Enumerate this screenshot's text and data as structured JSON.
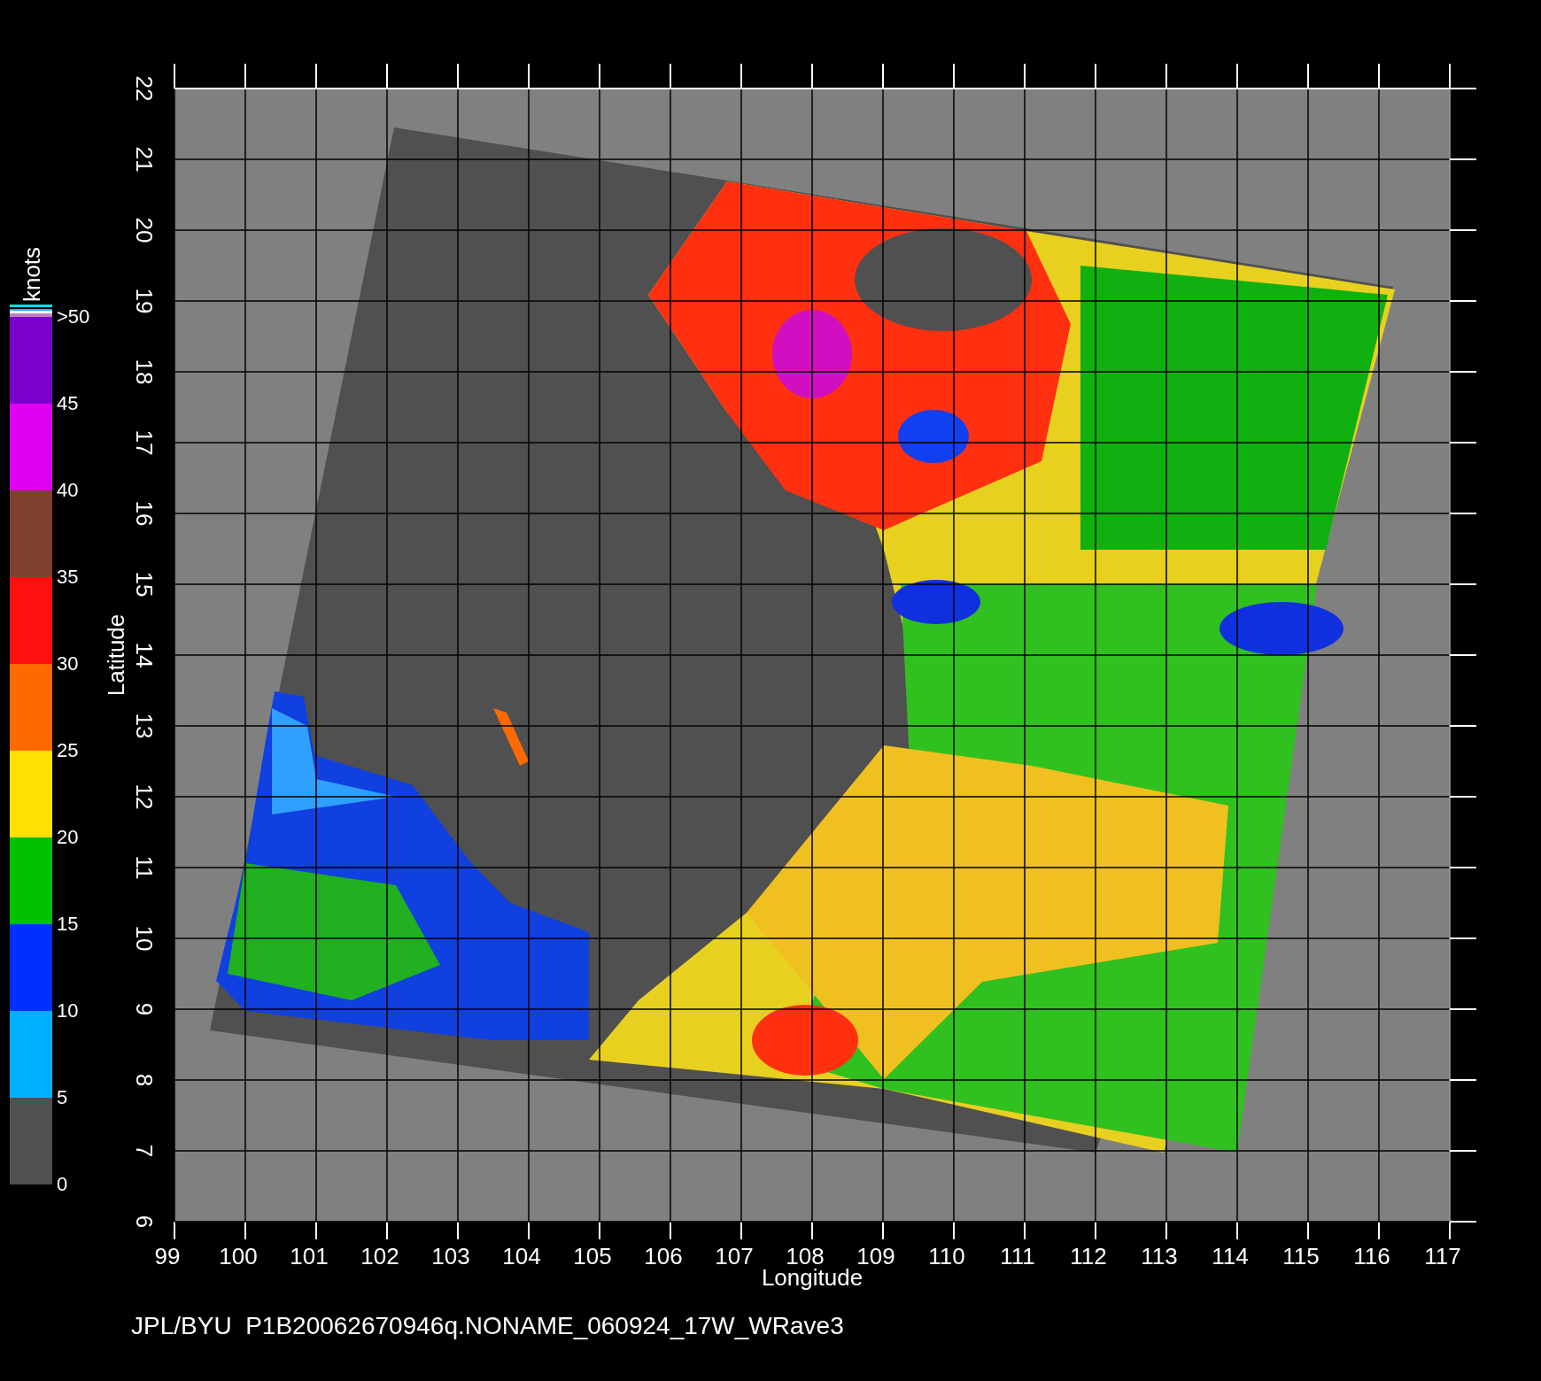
{
  "colorbar": {
    "unit": "knots",
    "segments": [
      {
        "label": ">50",
        "color": "#7a00cc"
      },
      {
        "label": "45",
        "color": "#e000f0"
      },
      {
        "label": "40",
        "color": "#804030"
      },
      {
        "label": "35",
        "color": "#ff1010"
      },
      {
        "label": "30",
        "color": "#ff6a00"
      },
      {
        "label": "25",
        "color": "#ffe000"
      },
      {
        "label": "20",
        "color": "#00c000"
      },
      {
        "label": "15",
        "color": "#0030ff"
      },
      {
        "label": "10",
        "color": "#00b0ff"
      },
      {
        "label": "5",
        "color": "#505050"
      }
    ],
    "bottom_label": "0"
  },
  "map": {
    "xlabel": "Longitude",
    "ylabel": "Latitude",
    "xticks": [
      "99",
      "100",
      "101",
      "102",
      "103",
      "104",
      "105",
      "106",
      "107",
      "108",
      "109",
      "110",
      "111",
      "112",
      "113",
      "114",
      "115",
      "116",
      "117"
    ],
    "yticks": [
      "6",
      "7",
      "8",
      "9",
      "10",
      "11",
      "12",
      "13",
      "14",
      "15",
      "16",
      "17",
      "18",
      "19",
      "20",
      "21",
      "22"
    ]
  },
  "caption": "JPL/BYU  P1B20062670946q.NONAME_060924_17W_WRave3"
}
